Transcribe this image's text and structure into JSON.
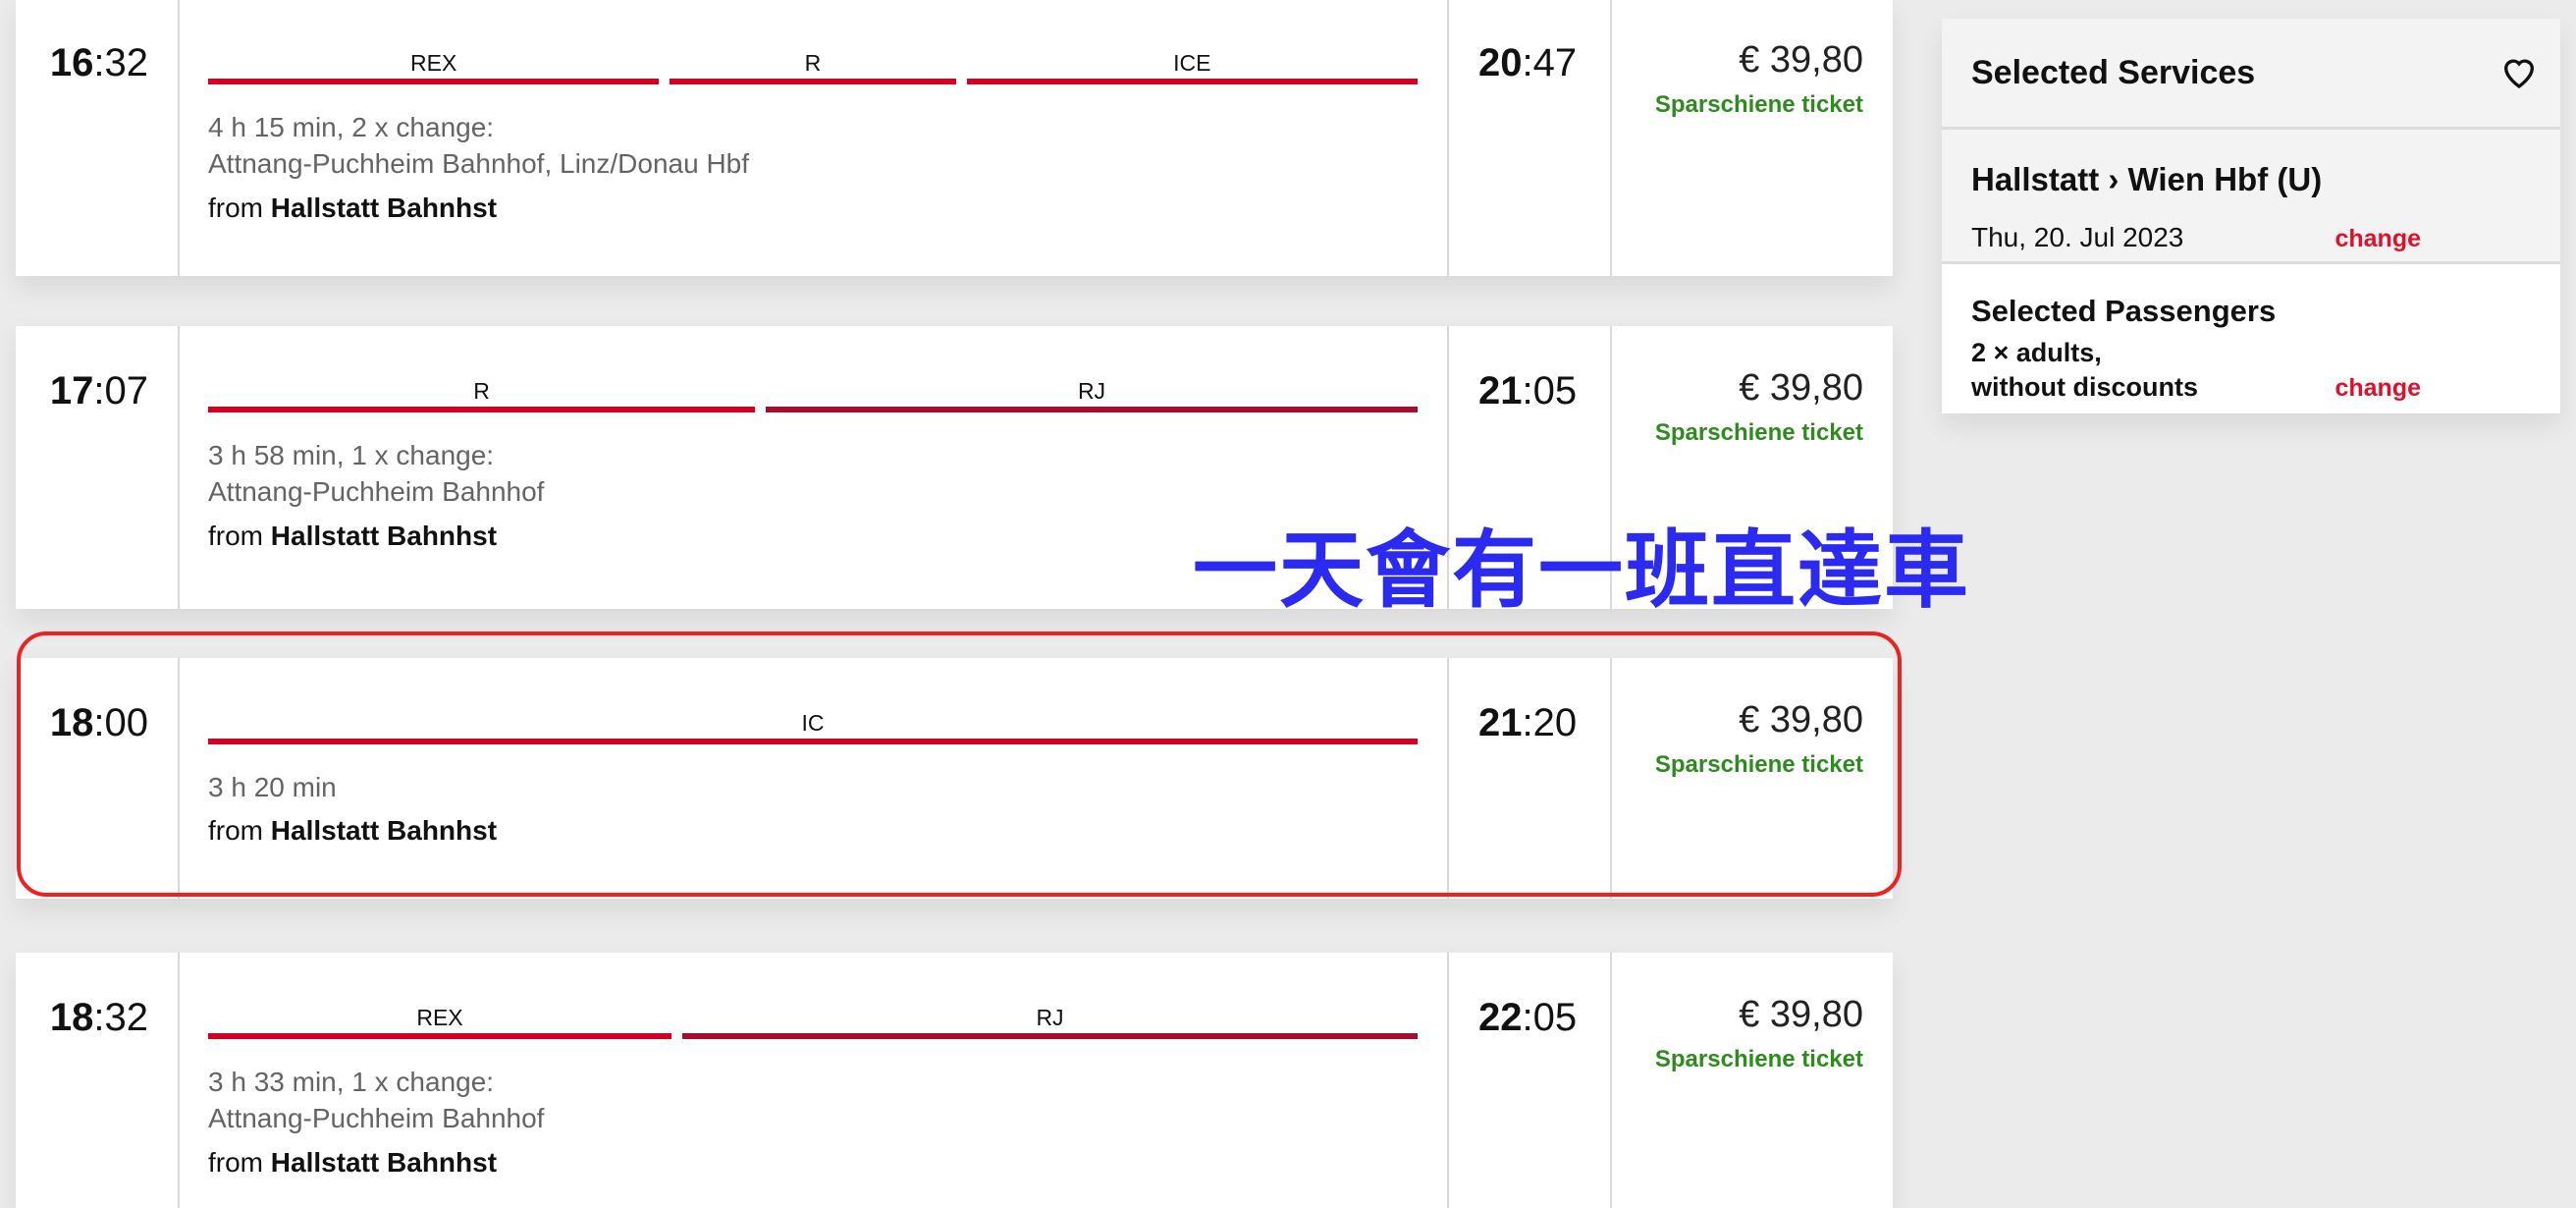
{
  "connections": [
    {
      "departure": {
        "h": "16",
        "m": ":32"
      },
      "arrival": {
        "h": "20",
        "m": ":47"
      },
      "segments": [
        {
          "label": "REX",
          "color": "#d4001f"
        },
        {
          "label": "R",
          "color": "#d4001f"
        },
        {
          "label": "ICE",
          "color": "#d4001f"
        }
      ],
      "duration": "4 h 15 min, 2 x change:",
      "changes": "Attnang-Puchheim Bahnhof, Linz/Donau Hbf",
      "from_prefix": "from",
      "from_station": "Hallstatt Bahnhst",
      "price": "€ 39,80",
      "ticket": "Sparschiene ticket"
    },
    {
      "departure": {
        "h": "17",
        "m": ":07"
      },
      "arrival": {
        "h": "21",
        "m": ":05"
      },
      "segments": [
        {
          "label": "R",
          "color": "#d4001f"
        },
        {
          "label": "RJ",
          "color": "#a50f2d"
        }
      ],
      "duration": "3 h 58 min, 1 x change:",
      "changes": "Attnang-Puchheim Bahnhof",
      "from_prefix": "from",
      "from_station": "Hallstatt Bahnhst",
      "price": "€ 39,80",
      "ticket": "Sparschiene ticket"
    },
    {
      "departure": {
        "h": "18",
        "m": ":00"
      },
      "arrival": {
        "h": "21",
        "m": ":20"
      },
      "segments": [
        {
          "label": "IC",
          "color": "#d4001f"
        }
      ],
      "duration": "3 h 20 min",
      "changes": "",
      "from_prefix": "from",
      "from_station": "Hallstatt Bahnhst",
      "price": "€ 39,80",
      "ticket": "Sparschiene ticket",
      "highlighted": true
    },
    {
      "departure": {
        "h": "18",
        "m": ":32"
      },
      "arrival": {
        "h": "22",
        "m": ":05"
      },
      "segments": [
        {
          "label": "REX",
          "color": "#d4001f"
        },
        {
          "label": "RJ",
          "color": "#a50f2d"
        }
      ],
      "duration": "3 h 33 min, 1 x change:",
      "changes": "Attnang-Puchheim Bahnhof",
      "from_prefix": "from",
      "from_station": "Hallstatt Bahnhst",
      "price": "€ 39,80",
      "ticket": "Sparschiene ticket"
    }
  ],
  "annotation": "一天會有一班直達車",
  "sidebar": {
    "title": "Selected Services",
    "favorite_icon": "heart-icon",
    "route": "Hallstatt › Wien Hbf (U)",
    "date": "Thu, 20. Jul 2023",
    "change_date_label": "change",
    "passengers_title": "Selected Passengers",
    "passengers_line1": "2 × adults,",
    "passengers_line2": "without discounts",
    "change_passengers_label": "change"
  },
  "colors": {
    "accent": "#d4001f",
    "ticket": "#2e8b1e",
    "highlight": "#f0201e",
    "annotation": "#2a2af0"
  }
}
